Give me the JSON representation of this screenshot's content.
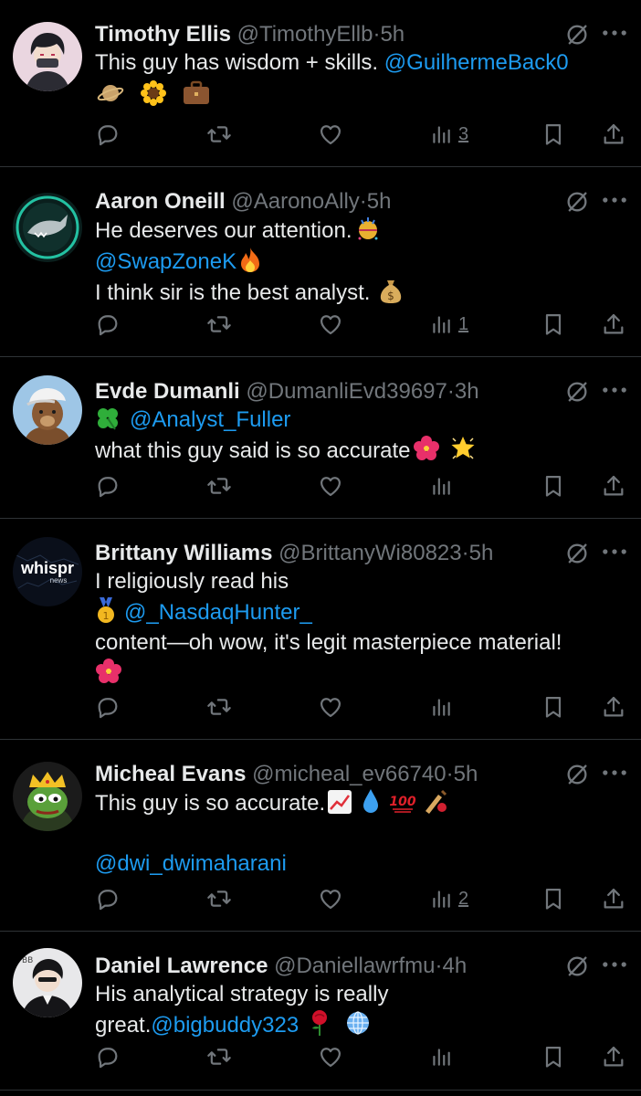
{
  "colors": {
    "background": "#000000",
    "text": "#e7e9ea",
    "muted": "#71767b",
    "link": "#1d9bf0",
    "divider": "#2f3336"
  },
  "tweets": [
    {
      "name": "Timothy Ellis",
      "handle": "@TimothyEllb",
      "dot": "·",
      "time": "5h",
      "lines": [
        {
          "pre": "This guy has wisdom + skills. ",
          "mention": "@GuilhermeBack0",
          "post": ""
        },
        {
          "pre": "",
          "mention": "",
          "post": ""
        }
      ],
      "emojis": [
        "ringed-planet-emoji",
        "sunflower-emoji",
        "briefcase-emoji"
      ],
      "views": "3"
    },
    {
      "name": "Aaron Oneill",
      "handle": "@AaronoAlly",
      "dot": "·",
      "time": "5h",
      "lines": [
        {
          "pre": "He deserves our attention.",
          "mention": "",
          "post": ""
        },
        {
          "pre": "",
          "mention": "@SwapZoneK",
          "post": ""
        },
        {
          "pre": "I think sir is the best analyst. ",
          "mention": "",
          "post": ""
        }
      ],
      "emojis": [
        "confetti-ball-emoji",
        "fire-emoji",
        "money-bag-emoji"
      ],
      "views": "1"
    },
    {
      "name": "Evde Dumanli",
      "handle": "@DumanliEvd39697",
      "dot": "·",
      "time": "3h",
      "lines": [
        {
          "pre": "",
          "mention": "@Analyst_Fuller",
          "post": ""
        },
        {
          "pre": "what this guy said is so accurate",
          "mention": "",
          "post": ""
        }
      ],
      "emojis": [
        "four-leaf-clover-emoji",
        "hibiscus-emoji",
        "glowing-star-emoji"
      ],
      "views": ""
    },
    {
      "name": "Brittany Williams",
      "handle": "@BrittanyWi80823",
      "dot": "·",
      "time": "5h",
      "avatar_text": "whispr",
      "avatar_subtext": "news",
      "lines": [
        {
          "pre": "I religiously read his",
          "mention": "",
          "post": ""
        },
        {
          "pre": "",
          "mention": "@_NasdaqHunter_",
          "post": ""
        },
        {
          "pre": " content—oh wow, it's legit masterpiece material!",
          "mention": "",
          "post": ""
        }
      ],
      "emojis": [
        "first-place-medal-emoji",
        "hibiscus-emoji"
      ],
      "views": ""
    },
    {
      "name": "Micheal Evans",
      "handle": "@micheal_ev66740",
      "dot": "·",
      "time": "5h",
      "lines": [
        {
          "pre": "This guy is so accurate.",
          "mention": "",
          "post": ""
        },
        {
          "pre": "",
          "mention": "@dwi_dwimaharani",
          "post": ""
        }
      ],
      "emojis": [
        "chart-increasing-emoji",
        "droplet-emoji",
        "hundred-points-emoji",
        "cricket-emoji"
      ],
      "views": "2"
    },
    {
      "name": "Daniel Lawrence",
      "handle": "@Daniellawrfmu",
      "dot": "·",
      "time": "4h",
      "lines": [
        {
          "pre": "His analytical strategy is really",
          "mention": "",
          "post": ""
        },
        {
          "pre": "great.",
          "mention": "@bigbuddy323",
          "post": ""
        }
      ],
      "emojis": [
        "rose-emoji",
        "globe-emoji"
      ],
      "views": ""
    }
  ]
}
